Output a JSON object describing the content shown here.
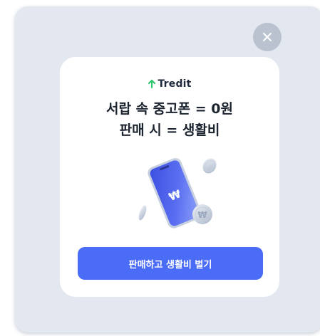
{
  "modal": {
    "close_icon": "close-icon",
    "logo_text": "Tredit",
    "headline_line1": "서랍 속 중고폰 = 0원",
    "headline_line2": "판매 시 = 생활비",
    "illustration_icon": "phone-with-won-coins-illustration",
    "cta_label": "판매하고 생활비 벌기"
  },
  "colors": {
    "accent": "#4a6cf7",
    "logo_mark": "#2bc46a",
    "backdrop": "#e3e8f0"
  }
}
